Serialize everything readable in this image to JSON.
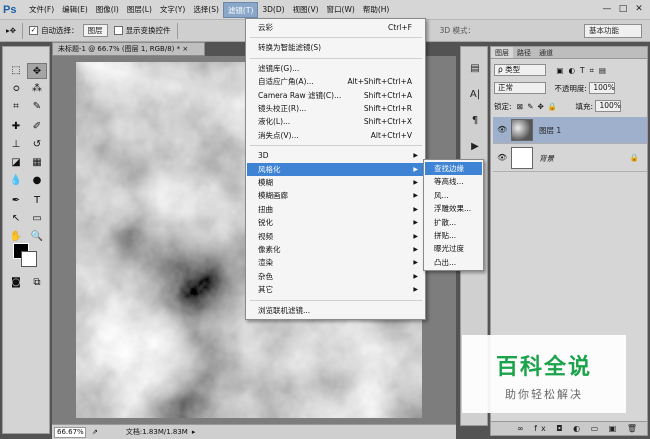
{
  "menubar": {
    "logo": "Ps",
    "items": [
      "文件(F)",
      "编辑(E)",
      "图像(I)",
      "图层(L)",
      "文字(Y)",
      "选择(S)",
      "滤镜(T)",
      "3D(D)",
      "视图(V)",
      "窗口(W)",
      "帮助(H)"
    ],
    "active_index": 6,
    "window_controls": [
      "—",
      "□",
      "✕"
    ]
  },
  "options": {
    "auto_select_label": "自动选择：",
    "auto_select_target": "图层",
    "show_transform_label": "显示变换控件",
    "mode_3d_label": "3D 模式：",
    "workspace": "基本功能"
  },
  "document": {
    "tab_title": "未标题-1 @ 66.7% (图层 1, RGB/8) *",
    "close": "×",
    "zoom": "66.67%",
    "doc_info": "文档:1.83M/1.83M"
  },
  "filter_menu": {
    "items": [
      {
        "label": "云彩",
        "shortcut": "Ctrl+F"
      },
      {
        "sep": true
      },
      {
        "label": "转换为智能滤镜(S)",
        "shortcut": ""
      },
      {
        "sep": true
      },
      {
        "label": "滤镜库(G)...",
        "shortcut": ""
      },
      {
        "label": "自适应广角(A)...",
        "shortcut": "Alt+Shift+Ctrl+A"
      },
      {
        "label": "Camera Raw 滤镜(C)...",
        "shortcut": "Shift+Ctrl+A"
      },
      {
        "label": "镜头校正(R)...",
        "shortcut": "Shift+Ctrl+R"
      },
      {
        "label": "液化(L)...",
        "shortcut": "Shift+Ctrl+X"
      },
      {
        "label": "消失点(V)...",
        "shortcut": "Alt+Ctrl+V"
      },
      {
        "sep": true
      },
      {
        "label": "3D",
        "submenu": true
      },
      {
        "label": "风格化",
        "submenu": true,
        "highlight": true
      },
      {
        "label": "模糊",
        "submenu": true
      },
      {
        "label": "模糊画廊",
        "submenu": true
      },
      {
        "label": "扭曲",
        "submenu": true
      },
      {
        "label": "锐化",
        "submenu": true
      },
      {
        "label": "视频",
        "submenu": true
      },
      {
        "label": "像素化",
        "submenu": true
      },
      {
        "label": "渲染",
        "submenu": true
      },
      {
        "label": "杂色",
        "submenu": true
      },
      {
        "label": "其它",
        "submenu": true
      },
      {
        "sep": true
      },
      {
        "label": "浏览联机滤镜...",
        "shortcut": ""
      }
    ]
  },
  "stylize_submenu": {
    "items": [
      "查找边缘",
      "等高线...",
      "风...",
      "浮雕效果...",
      "扩散...",
      "拼贴...",
      "曝光过度",
      "凸出..."
    ],
    "highlight_index": 0
  },
  "layers_panel": {
    "tabs": [
      "图层",
      "路径",
      "通道"
    ],
    "kind_filter": "ρ 类型",
    "blend_mode": "正常",
    "opacity_label": "不透明度:",
    "opacity_value": "100%",
    "lock_label": "锁定:",
    "fill_label": "填充:",
    "fill_value": "100%",
    "layers": [
      {
        "name": "图层 1",
        "selected": true,
        "locked": false
      },
      {
        "name": "背景",
        "selected": false,
        "locked": true
      }
    ],
    "footer_icons": "∞ fx ◘ ◐ ▭ ▣ 🗑"
  },
  "watermark": {
    "main": "百科全说",
    "sub": "助你轻松解决"
  }
}
